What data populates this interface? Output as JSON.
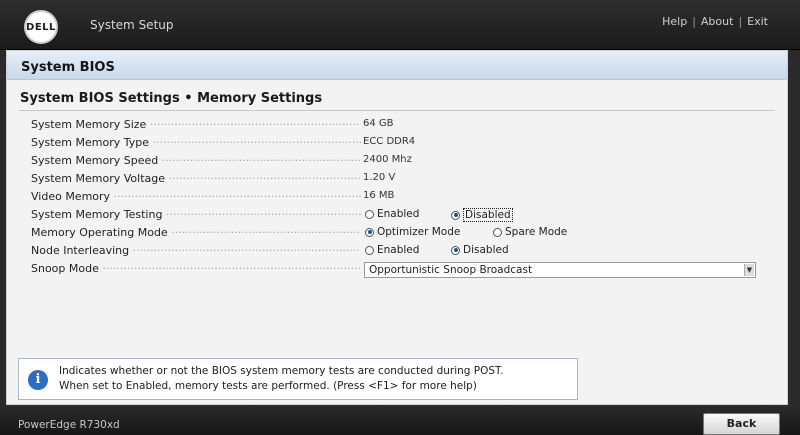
{
  "header": {
    "logo_text": "DELL",
    "app_title": "System Setup",
    "links": {
      "help": "Help",
      "about": "About",
      "exit": "Exit"
    },
    "separator": "|"
  },
  "panel": {
    "title": "System BIOS",
    "section_title": "System BIOS Settings • Memory Settings"
  },
  "settings": {
    "memory_size": {
      "label": "System Memory Size",
      "value": "64 GB"
    },
    "memory_type": {
      "label": "System Memory Type",
      "value": "ECC DDR4"
    },
    "memory_speed": {
      "label": "System Memory Speed",
      "value": "2400 Mhz"
    },
    "memory_voltage": {
      "label": "System Memory Voltage",
      "value": "1.20 V"
    },
    "video_memory": {
      "label": "Video Memory",
      "value": "16 MB"
    },
    "memory_testing": {
      "label": "System Memory Testing",
      "opt1": "Enabled",
      "opt2": "Disabled",
      "selected": "Disabled"
    },
    "operating_mode": {
      "label": "Memory Operating Mode",
      "opt1": "Optimizer Mode",
      "opt2": "Spare Mode",
      "selected": "Optimizer Mode"
    },
    "node_interleaving": {
      "label": "Node Interleaving",
      "opt1": "Enabled",
      "opt2": "Disabled",
      "selected": "Disabled"
    },
    "snoop_mode": {
      "label": "Snoop Mode",
      "value": "Opportunistic Snoop Broadcast"
    }
  },
  "help": {
    "line1": "Indicates whether or not the BIOS system memory tests are conducted during POST.",
    "line2": "When set to Enabled, memory tests are performed. (Press <F1> for more help)"
  },
  "footer": {
    "model": "PowerEdge R730xd",
    "back_label": "Back"
  },
  "colors": {
    "accent": "#2b6cc4",
    "header_bg": "#1b1b1b",
    "panel_head": "#c9d9ea"
  }
}
